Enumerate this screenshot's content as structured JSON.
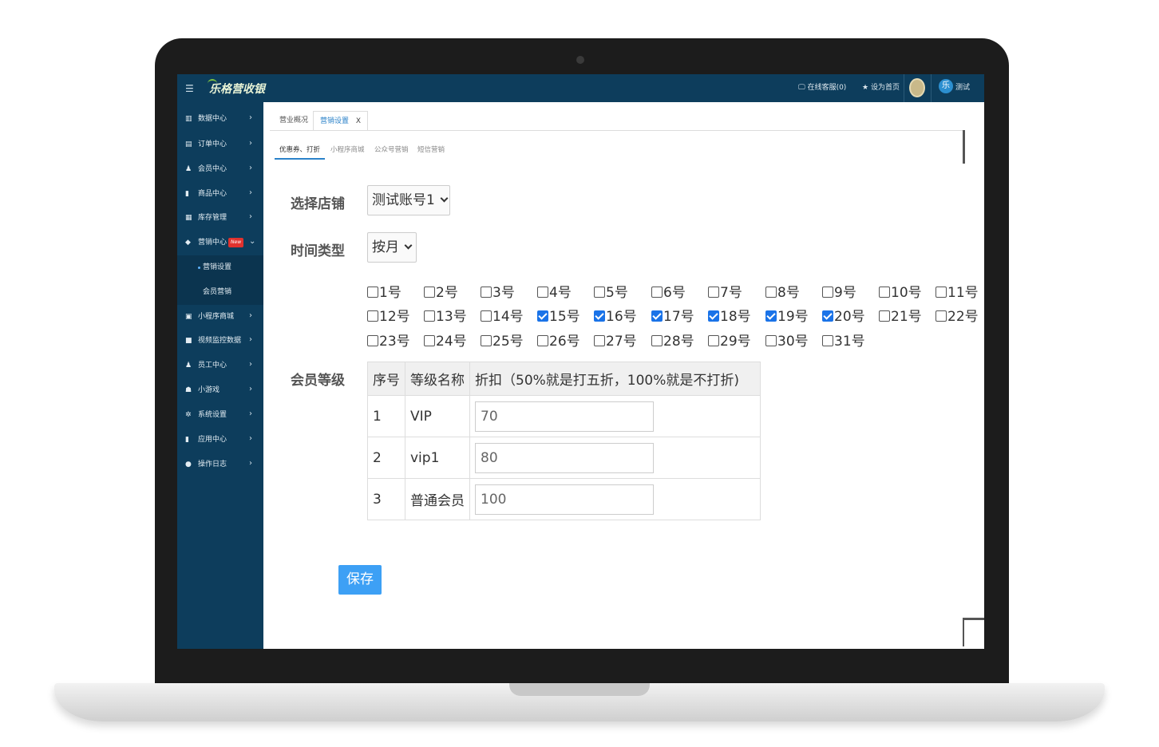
{
  "app": {
    "logo": "乐格营收银",
    "top_links": [
      "在线客服(0)",
      "设为首页"
    ],
    "user_name": "测试"
  },
  "sidebar": {
    "items": [
      {
        "label": "数据中心",
        "icon": "chart-icon"
      },
      {
        "label": "订单中心",
        "icon": "order-icon"
      },
      {
        "label": "会员中心",
        "icon": "user-icon"
      },
      {
        "label": "商品中心",
        "icon": "goods-icon"
      },
      {
        "label": "库存管理",
        "icon": "stock-icon"
      },
      {
        "label": "营销中心",
        "icon": "tag-icon",
        "badge": "New"
      },
      {
        "label": "小程序商城",
        "icon": "miniapp-icon"
      },
      {
        "label": "视频监控数据",
        "icon": "video-icon"
      },
      {
        "label": "员工中心",
        "icon": "staff-icon"
      },
      {
        "label": "小游戏",
        "icon": "game-icon"
      },
      {
        "label": "系统设置",
        "icon": "gear-icon"
      },
      {
        "label": "应用中心",
        "icon": "app-icon"
      },
      {
        "label": "操作日志",
        "icon": "info-icon"
      }
    ],
    "subitems": [
      {
        "label": "营销设置",
        "active": true
      },
      {
        "label": "会员营销",
        "active": false
      }
    ]
  },
  "tabs": [
    {
      "label": "营业概况"
    },
    {
      "label": "营销设置",
      "close": "X"
    }
  ],
  "subtabs": [
    "优惠券、打折",
    "小程序商城",
    "公众号营销",
    "短信营销"
  ],
  "form": {
    "store_label": "选择店铺",
    "store_value": "测试账号1",
    "time_type_label": "时间类型",
    "time_type_value": "按月",
    "member_level_label": "会员等级"
  },
  "days": [
    {
      "label": "1号",
      "checked": false
    },
    {
      "label": "2号",
      "checked": false
    },
    {
      "label": "3号",
      "checked": false
    },
    {
      "label": "4号",
      "checked": false
    },
    {
      "label": "5号",
      "checked": false
    },
    {
      "label": "6号",
      "checked": false
    },
    {
      "label": "7号",
      "checked": false
    },
    {
      "label": "8号",
      "checked": false
    },
    {
      "label": "9号",
      "checked": false
    },
    {
      "label": "10号",
      "checked": false
    },
    {
      "label": "11号",
      "checked": false
    },
    {
      "label": "12号",
      "checked": false
    },
    {
      "label": "13号",
      "checked": false
    },
    {
      "label": "14号",
      "checked": false
    },
    {
      "label": "15号",
      "checked": true
    },
    {
      "label": "16号",
      "checked": true
    },
    {
      "label": "17号",
      "checked": true
    },
    {
      "label": "18号",
      "checked": true
    },
    {
      "label": "19号",
      "checked": true
    },
    {
      "label": "20号",
      "checked": true
    },
    {
      "label": "21号",
      "checked": false
    },
    {
      "label": "22号",
      "checked": false
    },
    {
      "label": "23号",
      "checked": false
    },
    {
      "label": "24号",
      "checked": false
    },
    {
      "label": "25号",
      "checked": false
    },
    {
      "label": "26号",
      "checked": false
    },
    {
      "label": "27号",
      "checked": false
    },
    {
      "label": "28号",
      "checked": false
    },
    {
      "label": "29号",
      "checked": false
    },
    {
      "label": "30号",
      "checked": false
    },
    {
      "label": "31号",
      "checked": false
    }
  ],
  "levels_table": {
    "headers": [
      "序号",
      "等级名称",
      "折扣（50%就是打五折，100%就是不打折)"
    ],
    "rows": [
      {
        "no": "1",
        "name": "VIP",
        "discount": "70"
      },
      {
        "no": "2",
        "name": "vip1",
        "discount": "80"
      },
      {
        "no": "3",
        "name": "普通会员",
        "discount": "100"
      }
    ]
  },
  "save_label": "保存",
  "colors": {
    "sidebar_bg": "#0d3d5c",
    "accent": "#2b82c9",
    "save_button": "#3da0f5",
    "checkbox_on": "#1a73e8"
  }
}
